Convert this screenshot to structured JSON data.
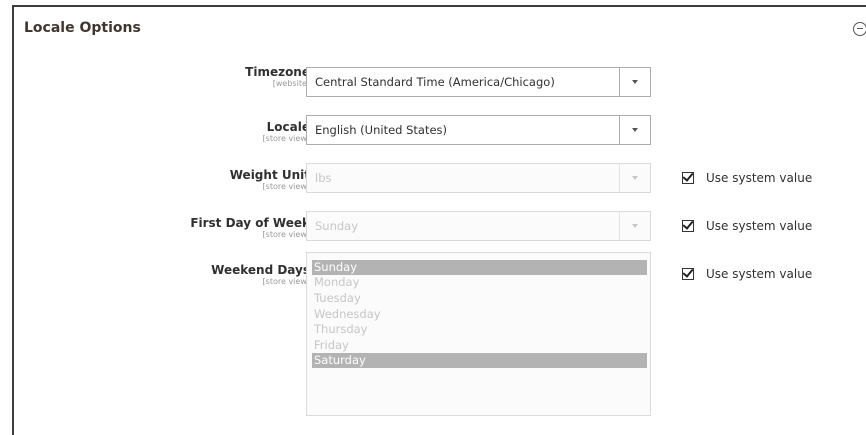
{
  "panel": {
    "title": "Locale Options"
  },
  "fields": {
    "timezone": {
      "label": "Timezone",
      "scope": "[website]",
      "value": "Central Standard Time (America/Chicago)"
    },
    "locale": {
      "label": "Locale",
      "scope": "[store view]",
      "value": "English (United States)"
    },
    "weight_unit": {
      "label": "Weight Unit",
      "scope": "[store view]",
      "value": "lbs",
      "use_system_label": "Use system value",
      "use_system_checked": true
    },
    "first_day": {
      "label": "First Day of Week",
      "scope": "[store view]",
      "value": "Sunday",
      "use_system_label": "Use system value",
      "use_system_checked": true
    },
    "weekend_days": {
      "label": "Weekend Days",
      "scope": "[store view]",
      "use_system_label": "Use system value",
      "use_system_checked": true,
      "options": [
        {
          "label": "Sunday",
          "selected": true
        },
        {
          "label": "Monday",
          "selected": false
        },
        {
          "label": "Tuesday",
          "selected": false
        },
        {
          "label": "Wednesday",
          "selected": false
        },
        {
          "label": "Thursday",
          "selected": false
        },
        {
          "label": "Friday",
          "selected": false
        },
        {
          "label": "Saturday",
          "selected": true
        }
      ]
    }
  }
}
